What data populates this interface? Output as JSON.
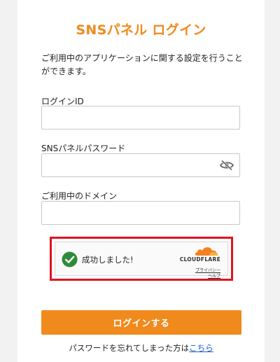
{
  "title": "SNSパネル ログイン",
  "description": "ご利用中のアプリケーションに関する設定を行うことができます。",
  "fields": {
    "login_id": {
      "label": "ログインID",
      "value": "",
      "placeholder": ""
    },
    "password": {
      "label": "SNSパネルパスワード",
      "value": "",
      "placeholder": "",
      "icon": "eye-slash-icon"
    },
    "domain": {
      "label": "ご利用中のドメイン",
      "value": "",
      "placeholder": ""
    }
  },
  "captcha": {
    "status_text": "成功しました!",
    "brand": "CLOUDFLARE",
    "privacy_link": "プライバシー",
    "help_link": "ヘルプ",
    "check_icon": "check-circle-icon",
    "highlight_color": "#e4131d"
  },
  "login_button": {
    "label": "ログインする"
  },
  "forgot": {
    "text": "パスワードを忘れてしまった方は",
    "link": "こちら"
  },
  "colors": {
    "accent": "#f08a1c",
    "success": "#2e8b3a",
    "link": "#1a5fd0"
  }
}
